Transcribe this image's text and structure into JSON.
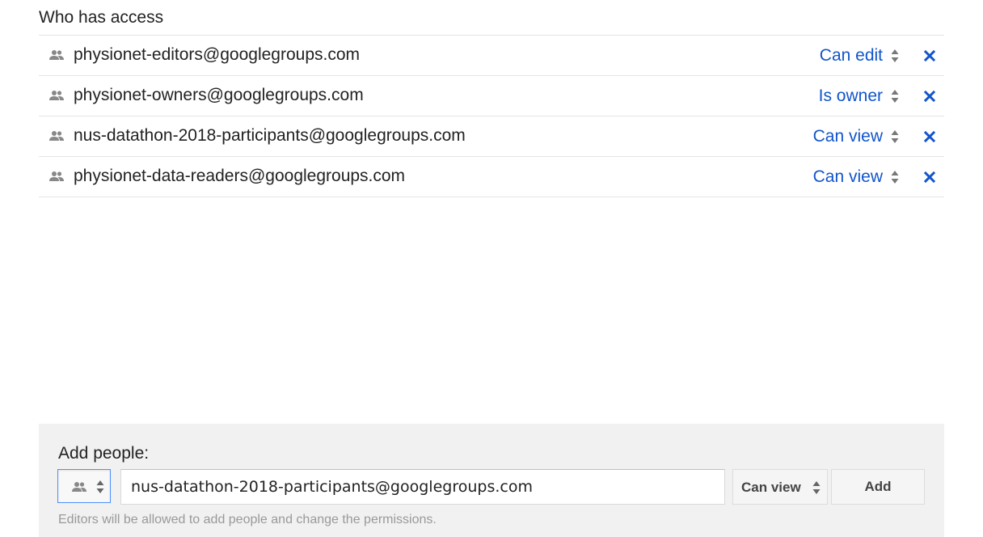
{
  "access": {
    "title": "Who has access",
    "entries": [
      {
        "email": "physionet-editors@googlegroups.com",
        "permission": "Can edit",
        "type_icon": "group-icon",
        "remove_icon": "close-icon"
      },
      {
        "email": "physionet-owners@googlegroups.com",
        "permission": "Is owner",
        "type_icon": "group-icon",
        "remove_icon": "close-icon"
      },
      {
        "email": "nus-datathon-2018-participants@googlegroups.com",
        "permission": "Can view",
        "type_icon": "group-icon",
        "remove_icon": "close-icon"
      },
      {
        "email": "physionet-data-readers@googlegroups.com",
        "permission": "Can view",
        "type_icon": "group-icon",
        "remove_icon": "close-icon"
      }
    ]
  },
  "add_people": {
    "label": "Add people:",
    "type_icon": "group-icon",
    "input_value": "nus-datathon-2018-participants@googlegroups.com",
    "permission": "Can view",
    "add_label": "Add",
    "hint": "Editors will be allowed to add people and change the permissions."
  },
  "colors": {
    "link": "#1155cc",
    "focus_border": "#4d90fe",
    "panel_bg": "#f1f1f1",
    "divider": "#e5e5e5",
    "hint_text": "#999999"
  }
}
